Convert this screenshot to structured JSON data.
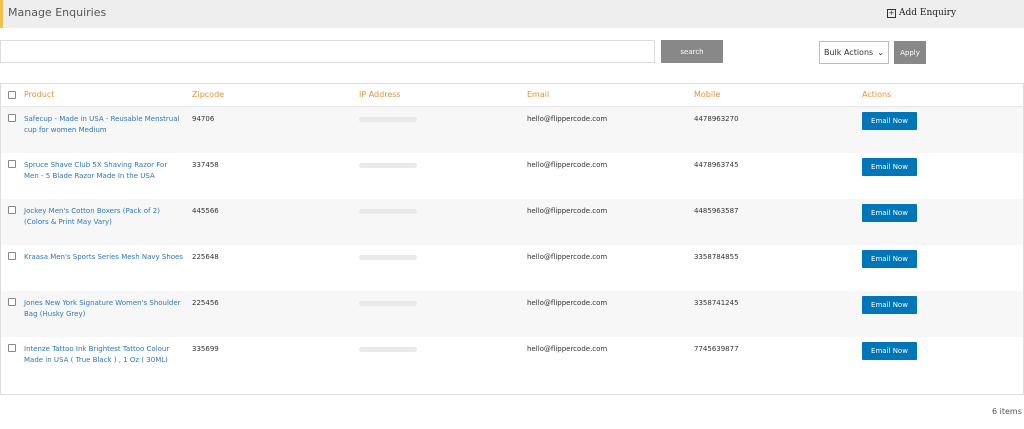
{
  "header": {
    "title": "Manage Enquiries",
    "add_label": "Add Enquiry"
  },
  "search": {
    "button_label": "search",
    "value": ""
  },
  "bulk": {
    "selected": "Bulk Actions",
    "apply_label": "Apply"
  },
  "table": {
    "columns": [
      "Product",
      "Zipcode",
      "IP Address",
      "Email",
      "Mobile",
      "Actions"
    ],
    "rows": [
      {
        "product": "Safecup - Made in USA - Reusable Menstrual cup for women Medium",
        "zipcode": "94706",
        "email": "hello@flippercode.com",
        "mobile": "4478963270",
        "action": "Email Now"
      },
      {
        "product": "Spruce Shave Club 5X Shaving Razor For Men - 5 Blade Razor Made In the USA",
        "zipcode": "337458",
        "email": "hello@flippercode.com",
        "mobile": "4478963745",
        "action": "Email Now"
      },
      {
        "product": "Jockey Men's Cotton Boxers (Pack of 2) (Colors & Print May Vary)",
        "zipcode": "445566",
        "email": "hello@flippercode.com",
        "mobile": "4485963587",
        "action": "Email Now"
      },
      {
        "product": "Kraasa Men's Sports Series Mesh Navy Shoes",
        "zipcode": "225648",
        "email": "hello@flippercode.com",
        "mobile": "3358784855",
        "action": "Email Now"
      },
      {
        "product": "Jones New York Signature Women's Shoulder Bag (Husky Grey)",
        "zipcode": "225456",
        "email": "hello@flippercode.com",
        "mobile": "3358741245",
        "action": "Email Now"
      },
      {
        "product": "Intenze Tattoo Ink Brightest Tattoo Colour Made in USA ( True Black ) , 1 Oz ( 30ML)",
        "zipcode": "335699",
        "email": "hello@flippercode.com",
        "mobile": "7745639877",
        "action": "Email Now"
      }
    ]
  },
  "footer": {
    "count": "6 items"
  },
  "colors": {
    "accent": "#e0923d",
    "link": "#2e77b6",
    "button": "#0075b8",
    "header_border": "#f0c24b"
  }
}
